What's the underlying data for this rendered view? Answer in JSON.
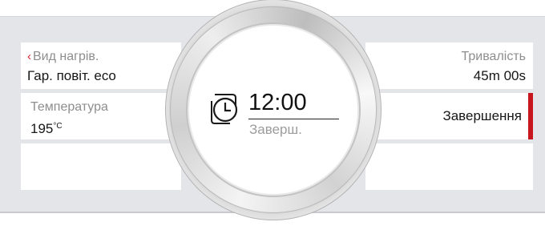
{
  "left_panels": [
    {
      "label": "Вид нагрів.",
      "value": "Гар. повіт. eco",
      "back_glyph": "‹"
    },
    {
      "label": "Температура",
      "value": "195",
      "unit": "°C"
    },
    {
      "label": "",
      "value": ""
    }
  ],
  "right_panels": [
    {
      "label": "Тривалість",
      "value": "45m 00s"
    },
    {
      "value": "Завершення",
      "selected": true
    },
    {
      "value": ""
    }
  ],
  "center": {
    "time": "12:00",
    "subtitle": "Заверш.",
    "icon": "clock-calendar-icon"
  },
  "colors": {
    "accent": "#c8161e",
    "back_arrow": "#d9232e",
    "background_band": "#e4e5e9",
    "label_gray": "#8e8e8e"
  }
}
